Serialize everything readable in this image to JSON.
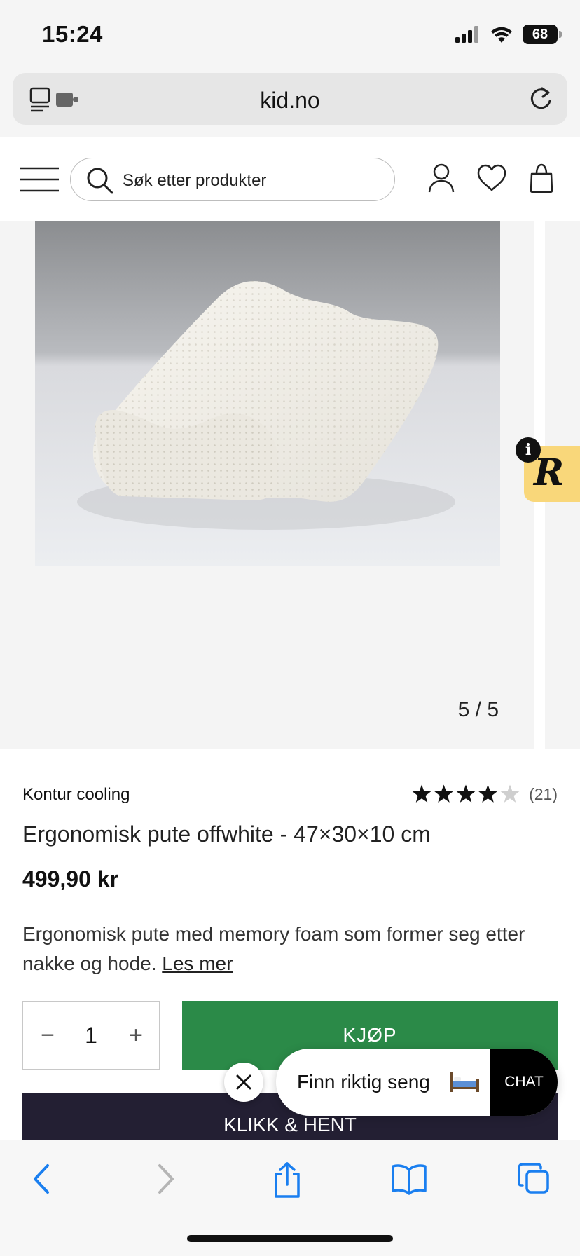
{
  "status": {
    "time": "15:24",
    "battery": "68"
  },
  "browser": {
    "url": "kid.no"
  },
  "header": {
    "search_placeholder": "Søk etter produkter"
  },
  "gallery": {
    "counter": "5 / 5",
    "current": 5,
    "total": 5
  },
  "product": {
    "brand": "Kontur cooling",
    "rating": 4,
    "rating_max": 5,
    "review_count": "(21)",
    "title": "Ergonomisk pute offwhite - 47×30×10 cm",
    "price": "499,90 kr",
    "description": "Ergonomisk pute med memory foam som former seg etter nakke og hode.",
    "read_more": "Les mer"
  },
  "purchase": {
    "quantity": "1",
    "minus": "−",
    "plus": "+",
    "buy_label": "KJØP",
    "click_collect_label": "KLIKK & HENT"
  },
  "chat": {
    "prompt": "Finn riktig seng",
    "button": "CHAT"
  },
  "colors": {
    "buy": "#2b8a48",
    "click_collect": "#231f33",
    "review_badge": "#f9d77a",
    "safari_blue": "#1a7ff0"
  }
}
